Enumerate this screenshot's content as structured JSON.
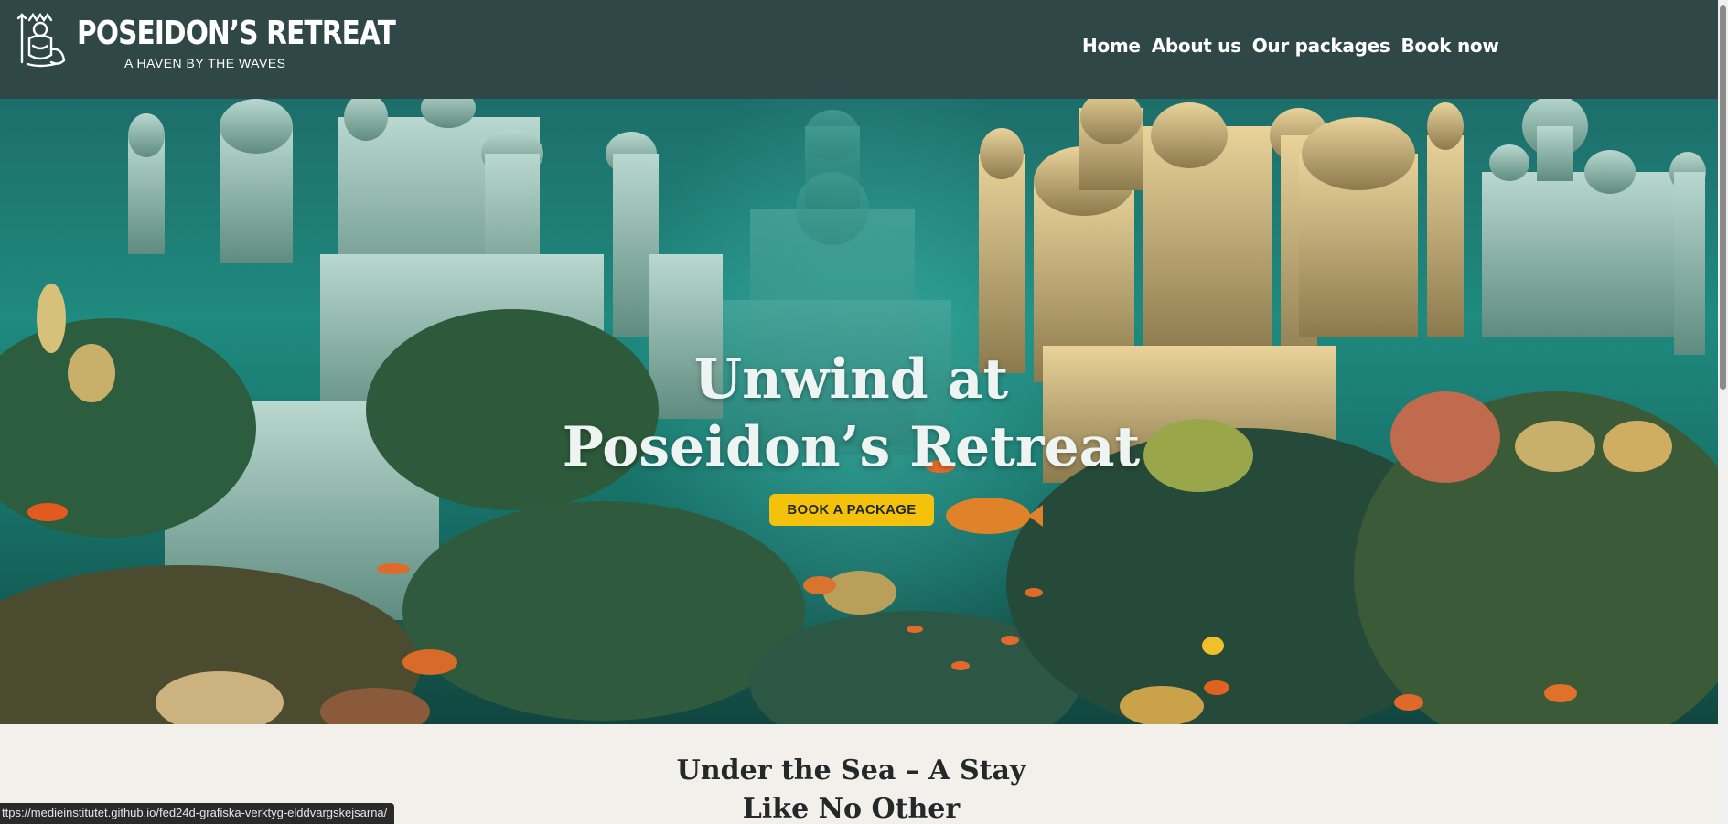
{
  "header": {
    "brand_title": "POSEIDON’S RETREAT",
    "brand_tagline": "A HAVEN BY THE WAVES",
    "nav": [
      {
        "label": "Home"
      },
      {
        "label": "About us"
      },
      {
        "label": "Our packages"
      },
      {
        "label": "Book now"
      }
    ]
  },
  "hero": {
    "title_line1": "Unwind at",
    "title_line2": "Poseidon’s Retreat",
    "cta_label": "BOOK A PACKAGE"
  },
  "intro": {
    "heading_line1": "Under the Sea – A Stay",
    "heading_line2": "Like No Other"
  },
  "status_bar": {
    "url": "ttps://medieinstitutet.github.io/fed24d-grafiska-verktyg-elddvargskejsarna/"
  },
  "colors": {
    "header_bg": "#2f4847",
    "cta_bg": "#f4c20d",
    "page_bg": "#f3efea"
  },
  "icons": {
    "logo": "poseidon-trident-logo-icon"
  }
}
